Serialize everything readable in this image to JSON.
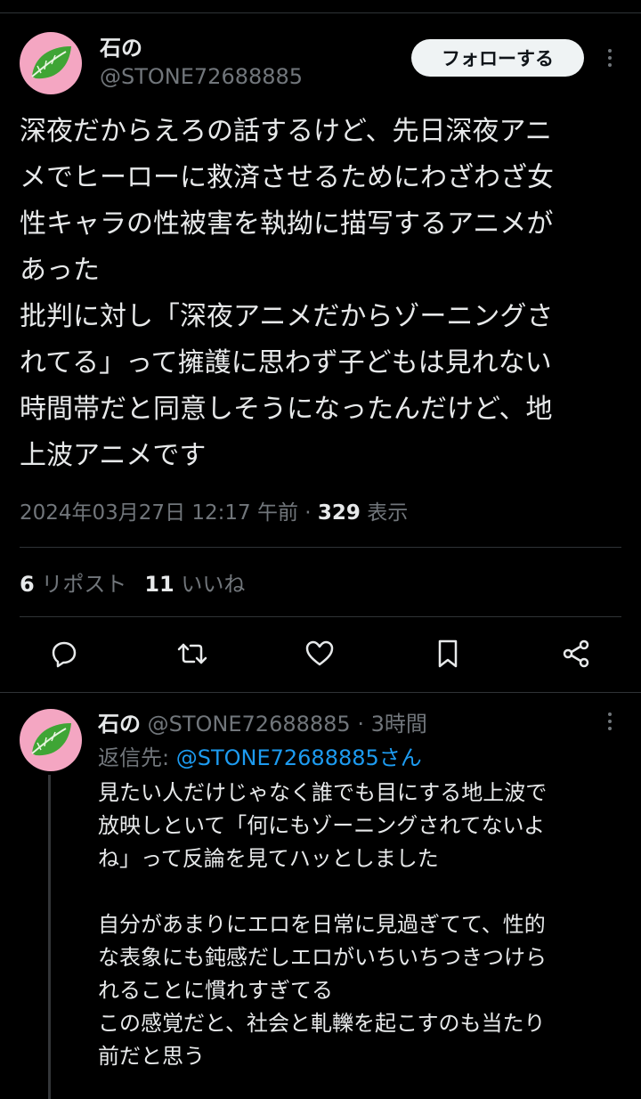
{
  "tweet": {
    "author_name": "石の",
    "author_handle": "@STONE72688885",
    "follow_label": "フォローする",
    "text": "深夜だからえろの話するけど、先日深夜アニ\nメでヒーローに救済させるためにわざわざ女\n性キャラの性被害を執拗に描写するアニメが\nあった\n批判に対し「深夜アニメだからゾーニングさ\nれてる」って擁護に思わず子どもは見れない\n時間帯だと同意しそうになったんだけど、地\n上波アニメです",
    "timestamp": "2024年03月27日 12:17 午前 · ",
    "views_count": "329",
    "views_label": " 表示",
    "retweets_count": "6",
    "retweets_label": " リポスト",
    "likes_count": "11",
    "likes_label": " いいね"
  },
  "reply": {
    "author_name": "石の",
    "meta": " @STONE72688885 · 3時間",
    "reply_to_label": "返信先: ",
    "reply_to_mention": "@STONE72688885さん",
    "text": "見たい人だけじゃなく誰でも目にする地上波で\n放映しといて「何にもゾーニングされてないよ\nね」って反論を見てハッとしました\n\n自分があまりにエロを日常に見過ぎてて、性的\nな表象にも鈍感だしエロがいちいちつきつけら\nれることに慣れすぎてる\nこの感覚だと、社会と軋轢を起こすのも当たり\n前だと思う"
  },
  "colors": {
    "background": "#000000",
    "text_primary": "#e7e9ea",
    "text_secondary": "#71767b",
    "link": "#1d9bf0",
    "avatar_bg": "#f4a6c2",
    "leaf": "#3fa535"
  },
  "icons": {
    "avatar": "green-leaf-avatar",
    "reply": "reply-icon",
    "retweet": "retweet-icon",
    "like": "heart-icon",
    "bookmark": "bookmark-icon",
    "share": "share-icon",
    "more": "more-options-icon"
  }
}
